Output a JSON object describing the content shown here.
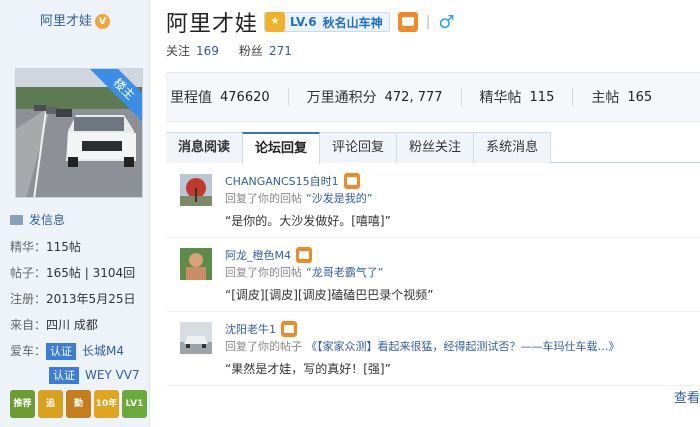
{
  "sidebar": {
    "username": "阿里才娃",
    "v_badge": "V",
    "ribbon": "楼主",
    "send_message": "发信息",
    "info": [
      {
        "label": "精华：",
        "value": "115帖"
      },
      {
        "label": "帖子：",
        "value": "165帖 | 3104回"
      },
      {
        "label": "注册：",
        "value": "2013年5月25日"
      },
      {
        "label": "来自：",
        "value": "四川 成都"
      }
    ],
    "car_label": "爱车：",
    "cars": [
      {
        "tag": "认证",
        "name": "长城M4"
      },
      {
        "tag": "认证",
        "name": "WEY VV7"
      }
    ],
    "medals": [
      {
        "text": "推荐",
        "color": "#6c9b2f"
      },
      {
        "text": "追",
        "color": "#d8a21c"
      },
      {
        "text": "勤",
        "color": "#c47f1c"
      },
      {
        "text": "10年",
        "color": "#e0a41e"
      },
      {
        "text": "LV1",
        "color": "#6aaa3a"
      }
    ]
  },
  "header": {
    "name": "阿里才娃",
    "level": "LV.6",
    "level_title": "秋名山车神",
    "separator": "|",
    "gender_symbol": "♂",
    "follow_label": "关注",
    "follow_count": "169",
    "fans_label": "粉丝",
    "fans_count": "271"
  },
  "stats": [
    {
      "label": "里程值",
      "value": "476620"
    },
    {
      "label": "万里通积分",
      "value": "472, 777"
    },
    {
      "label": "精华帖",
      "value": "115"
    },
    {
      "label": "主帖",
      "value": "165"
    }
  ],
  "tabs": [
    {
      "label": "消息阅读"
    },
    {
      "label": "论坛回复"
    },
    {
      "label": "评论回复"
    },
    {
      "label": "粉丝关注"
    },
    {
      "label": "系统消息"
    }
  ],
  "feed": [
    {
      "user": "CHANGANCS15自时1",
      "action": "回复了你的回帖",
      "topic": "“沙发是我的”",
      "quote": "“是你的。大沙发做好。[嘻嘻]”"
    },
    {
      "user": "阿龙_橙色M4",
      "action": "回复了你的回帖",
      "topic": "“龙哥老霸气了”",
      "quote": "“[调皮][调皮][调皮]磕磕巴巴录个视频”"
    },
    {
      "user": "沈阳老牛1",
      "action": "回复了你的帖子",
      "topic": "《【家家众测】看起来很猛，经得起测试否？——车玛仕车载…》",
      "quote": "“果然是才娃，写的真好！[强]”"
    }
  ],
  "more_link": "查看"
}
